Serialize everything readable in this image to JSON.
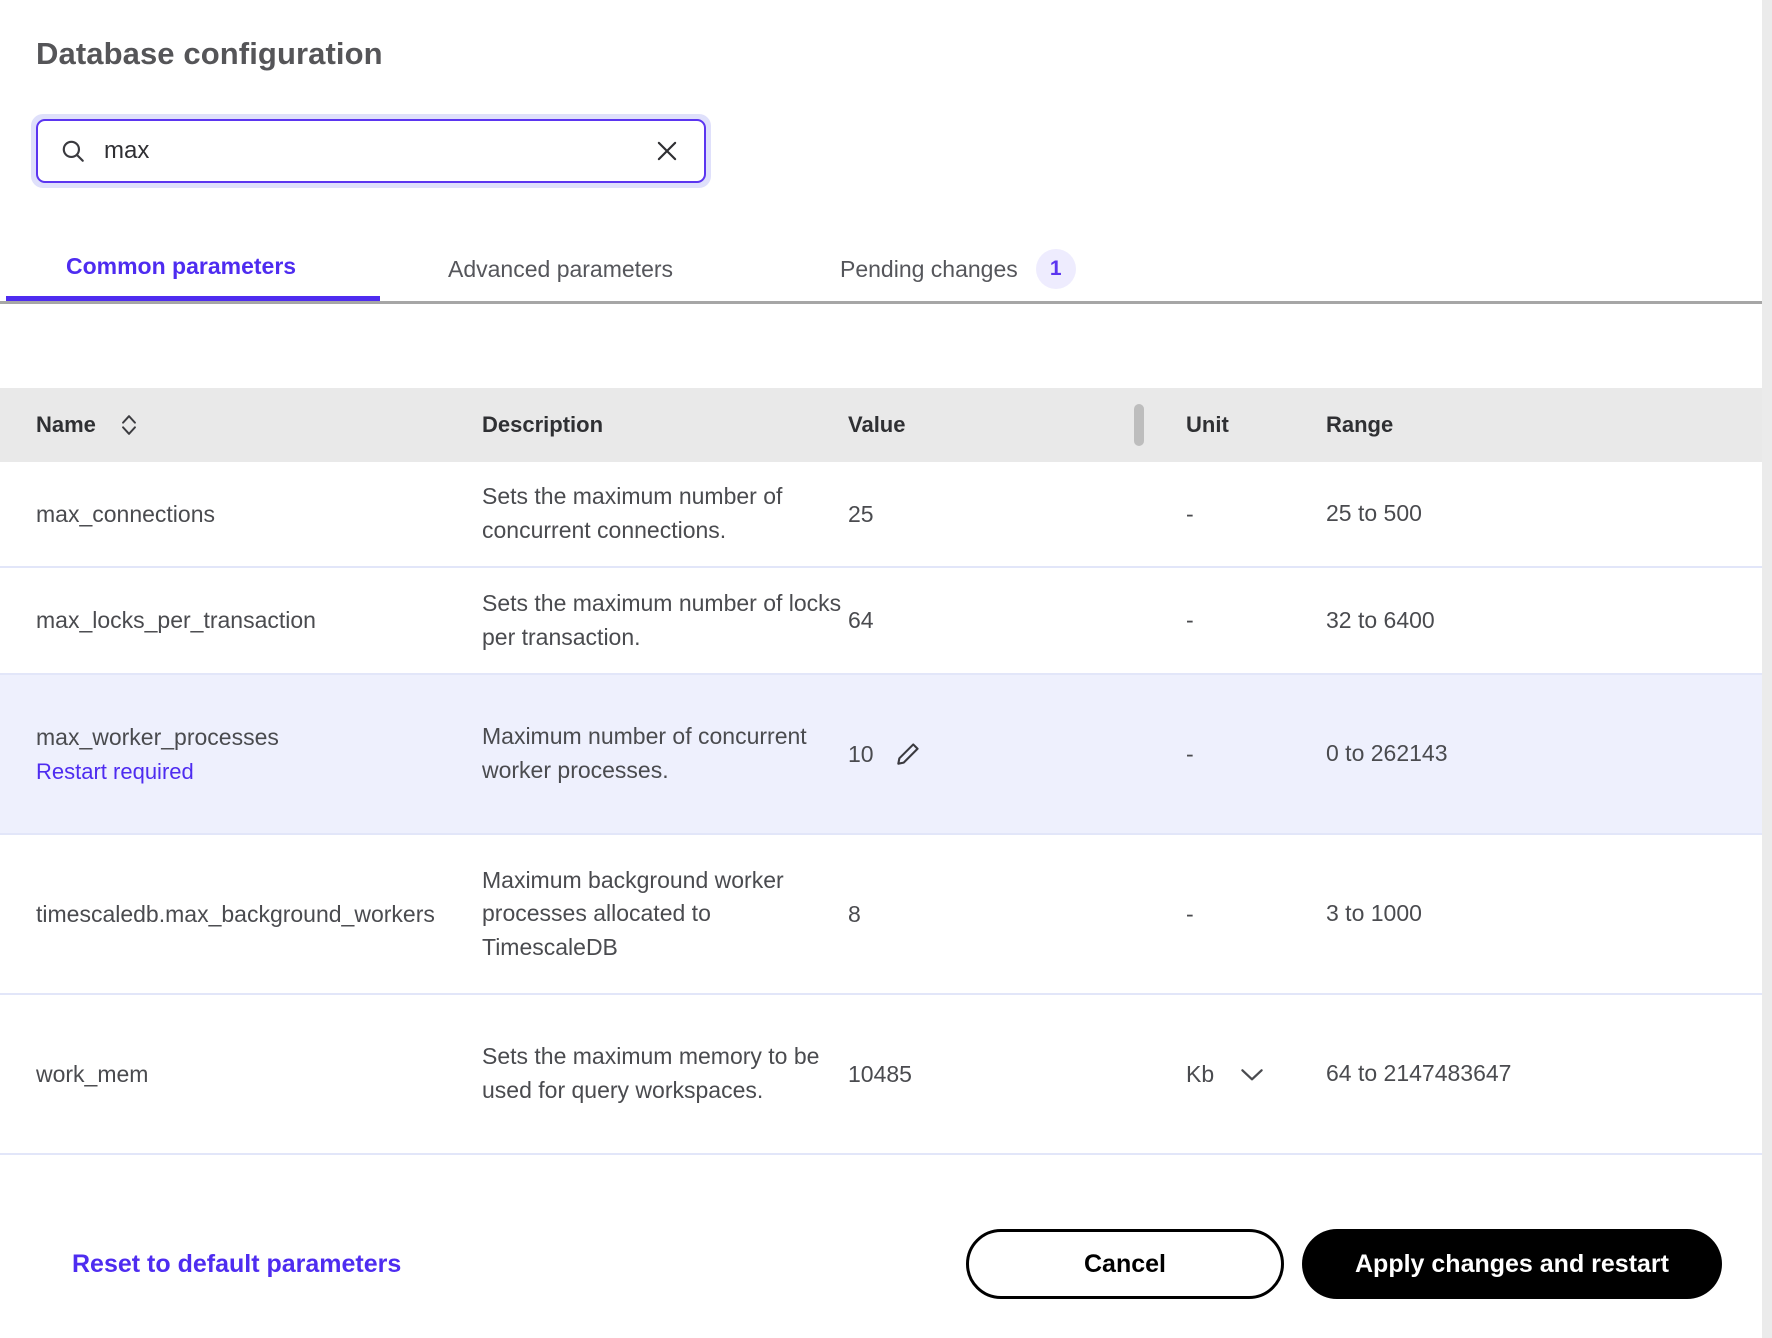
{
  "page": {
    "title": "Database configuration"
  },
  "search": {
    "icon": "search-icon",
    "value": "max",
    "placeholder": "Search parameters",
    "clear_icon": "close-icon"
  },
  "tabs": [
    {
      "label": "Common parameters",
      "active": true,
      "badge": null
    },
    {
      "label": "Advanced parameters",
      "active": false,
      "badge": null
    },
    {
      "label": "Pending changes",
      "active": false,
      "badge": "1"
    }
  ],
  "table": {
    "columns": {
      "name": "Name",
      "description": "Description",
      "value": "Value",
      "unit": "Unit",
      "range": "Range"
    },
    "sort_icon": "sort-icon",
    "column_resize_grip": "column-resize-grip",
    "rows": [
      {
        "name": "max_connections",
        "note": null,
        "description": "Sets the maximum number of concurrent connections.",
        "value": "25",
        "editable": false,
        "unit": "-",
        "unit_select": false,
        "range": "25 to 500",
        "highlight": false
      },
      {
        "name": "max_locks_per_transaction",
        "note": null,
        "description": "Sets the maximum number of locks per transaction.",
        "value": "64",
        "editable": false,
        "unit": "-",
        "unit_select": false,
        "range": "32 to 6400",
        "highlight": false
      },
      {
        "name": "max_worker_processes",
        "note": "Restart required",
        "description": "Maximum number of concurrent worker processes.",
        "value": "10",
        "editable": true,
        "edit_icon": "pencil-icon",
        "unit": "-",
        "unit_select": false,
        "range": "0 to 262143",
        "highlight": true
      },
      {
        "name": "timescaledb.max_background_workers",
        "note": null,
        "description": "Maximum background worker processes allocated to TimescaleDB",
        "value": "8",
        "editable": false,
        "unit": "-",
        "unit_select": false,
        "range": "3 to 1000",
        "highlight": false
      },
      {
        "name": "work_mem",
        "note": null,
        "description": "Sets the maximum memory to be used for query workspaces.",
        "value": "10485",
        "editable": false,
        "unit": "Kb",
        "unit_select": true,
        "unit_caret_icon": "chevron-down-icon",
        "range": "64 to 2147483647",
        "highlight": false
      }
    ]
  },
  "footer": {
    "reset_label": "Reset to default parameters",
    "cancel_label": "Cancel",
    "apply_label": "Apply changes and restart"
  },
  "colors": {
    "accent": "#4e2cf0",
    "accent_light": "#eeecfe",
    "row_highlight": "#eef0fd",
    "header_bg": "#e9e9e9",
    "row_divider": "#e2e6f9",
    "primary_button_bg": "#000000"
  }
}
